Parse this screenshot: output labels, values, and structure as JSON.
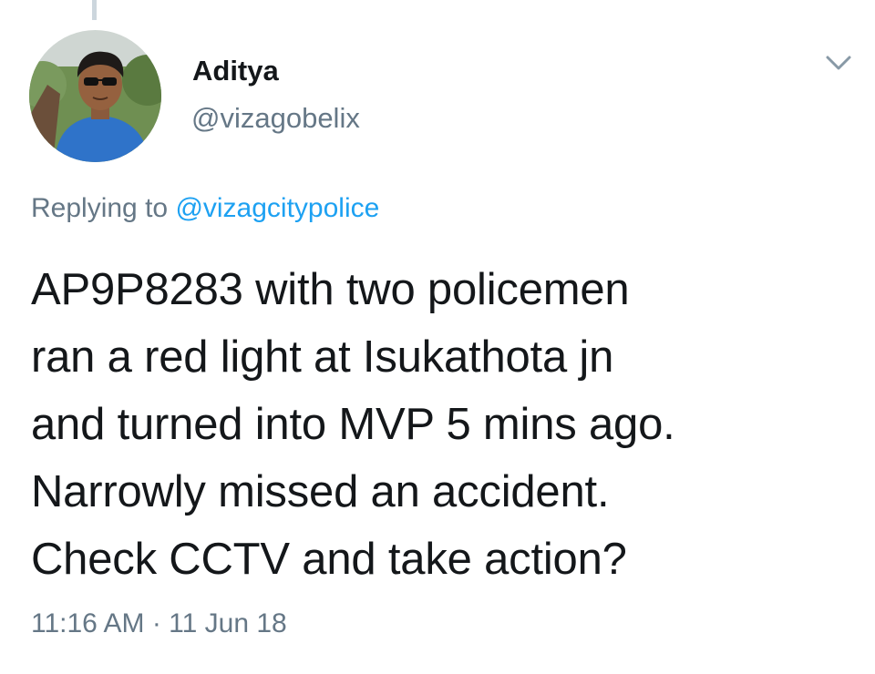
{
  "tweet": {
    "author": {
      "display_name": "Aditya",
      "handle": "@vizagobelix"
    },
    "reply": {
      "prefix": "Replying to",
      "mention": "@vizagcitypolice"
    },
    "text_lines": [
      "AP9P8283 with two policemen",
      "ran a red light at Isukathota jn",
      "and turned into MVP 5 mins ago.",
      "Narrowly missed an accident.",
      "Check CCTV and take action?"
    ],
    "timestamp": "11:16 AM · 11 Jun 18"
  },
  "icons": {
    "more_menu": "chevron-down-icon"
  },
  "colors": {
    "text_primary": "#14171a",
    "text_secondary": "#657786",
    "link": "#1da1f2",
    "thread_line": "#ccd6dd"
  }
}
